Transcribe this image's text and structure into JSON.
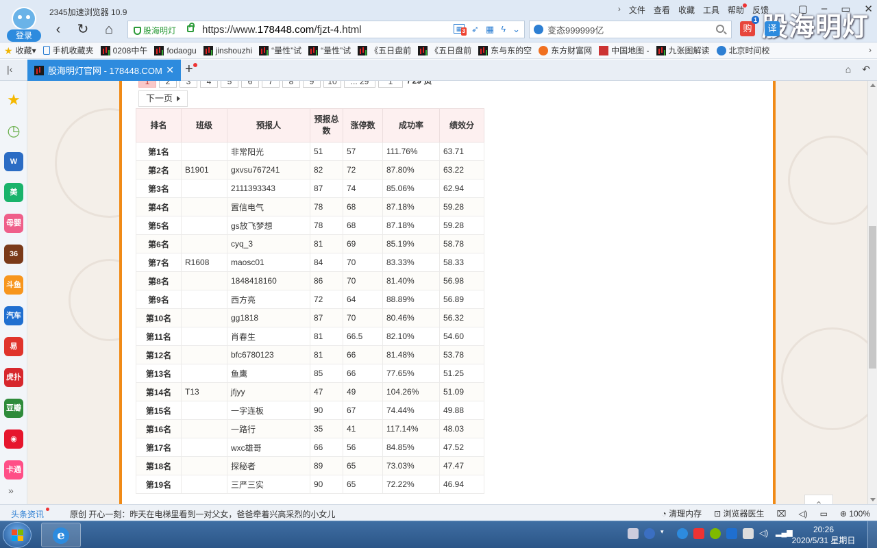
{
  "browser": {
    "app_title": "2345加速浏览器 10.9",
    "login_label": "登录",
    "menu": [
      "文件",
      "查看",
      "收藏",
      "工具",
      "帮助",
      "反馈"
    ],
    "watermark": "股海明灯",
    "address": {
      "site_badge": "股海明灯",
      "url_prefix": "https://www.",
      "url_domain": "178448.com",
      "url_path": "/fjzt-4.html",
      "badge_count": "3"
    },
    "search": {
      "value": "变态999999亿"
    },
    "buy_label": "购",
    "buy_badge": "1",
    "translate_label": "译"
  },
  "bookmarks": [
    {
      "label": "收藏",
      "icon": "star"
    },
    {
      "label": "手机收藏夹",
      "icon": "phone"
    },
    {
      "label": "0208中午",
      "icon": "stock"
    },
    {
      "label": "fodaogu",
      "icon": "stock"
    },
    {
      "label": "jinshouzhi",
      "icon": "stock"
    },
    {
      "label": "“量性”试",
      "icon": "stock"
    },
    {
      "label": "“量性”试",
      "icon": "stock"
    },
    {
      "label": "《五日盘前",
      "icon": "stock"
    },
    {
      "label": "《五日盘前",
      "icon": "stock"
    },
    {
      "label": "东与东的空",
      "icon": "stock"
    },
    {
      "label": "东方财富网",
      "icon": "hot"
    },
    {
      "label": "中国地图 -",
      "icon": "map"
    },
    {
      "label": "九张图解读",
      "icon": "stock"
    },
    {
      "label": "北京时间校",
      "icon": "paw"
    }
  ],
  "tab": {
    "title": "股海明灯官网 - 178448.COM"
  },
  "sidebar": [
    {
      "name": "favorites-icon",
      "label": "★",
      "color": "#f5b800"
    },
    {
      "name": "history-icon",
      "label": "◷",
      "color": "#6ab04c"
    },
    {
      "name": "word-icon",
      "label": "W",
      "color": "#2b6cc4"
    },
    {
      "name": "meituan-icon",
      "label": "美",
      "color": "#19b36b"
    },
    {
      "name": "muying-icon",
      "label": "母婴",
      "color": "#ef5f8a"
    },
    {
      "name": "game-icon",
      "label": "36",
      "color": "#7a3a1a"
    },
    {
      "name": "douyu-icon",
      "label": "斗鱼",
      "color": "#f7961e"
    },
    {
      "name": "car-icon",
      "label": "汽车",
      "color": "#1f6fd0"
    },
    {
      "name": "yi-icon",
      "label": "易",
      "color": "#e0342c"
    },
    {
      "name": "hupu-icon",
      "label": "虎扑",
      "color": "#d7272d"
    },
    {
      "name": "douban-icon",
      "label": "豆瓣",
      "color": "#2e8b3a"
    },
    {
      "name": "weibo-icon",
      "label": "◉",
      "color": "#e6162d"
    },
    {
      "name": "katong-icon",
      "label": "卡通",
      "color": "#ff4f87"
    }
  ],
  "pager": {
    "pages": [
      "1",
      "2",
      "3",
      "4",
      "5",
      "6",
      "7",
      "8",
      "9",
      "10",
      "... 29"
    ],
    "current": "1",
    "page_input": "1",
    "total": "/ 29 页",
    "next_label": "下一页"
  },
  "table": {
    "headers": [
      "排名",
      "班级",
      "预报人",
      "预报总数",
      "涨停数",
      "成功率",
      "绩效分"
    ],
    "rows": [
      [
        "第1名",
        "",
        "非常阳光",
        "51",
        "57",
        "111.76%",
        "63.71"
      ],
      [
        "第2名",
        "B1901",
        "gxvsu767241",
        "82",
        "72",
        "87.80%",
        "63.22"
      ],
      [
        "第3名",
        "",
        "2111393343",
        "87",
        "74",
        "85.06%",
        "62.94"
      ],
      [
        "第4名",
        "",
        "置信电气",
        "78",
        "68",
        "87.18%",
        "59.28"
      ],
      [
        "第5名",
        "",
        "gs放飞梦想",
        "78",
        "68",
        "87.18%",
        "59.28"
      ],
      [
        "第6名",
        "",
        "cyq_3",
        "81",
        "69",
        "85.19%",
        "58.78"
      ],
      [
        "第7名",
        "R1608",
        "maosc01",
        "84",
        "70",
        "83.33%",
        "58.33"
      ],
      [
        "第8名",
        "",
        "1848418160",
        "86",
        "70",
        "81.40%",
        "56.98"
      ],
      [
        "第9名",
        "",
        "西方亮",
        "72",
        "64",
        "88.89%",
        "56.89"
      ],
      [
        "第10名",
        "",
        "gg1818",
        "87",
        "70",
        "80.46%",
        "56.32"
      ],
      [
        "第11名",
        "",
        "肖春生",
        "81",
        "66.5",
        "82.10%",
        "54.60"
      ],
      [
        "第12名",
        "",
        "bfc6780123",
        "81",
        "66",
        "81.48%",
        "53.78"
      ],
      [
        "第13名",
        "",
        "鱼鹰",
        "85",
        "66",
        "77.65%",
        "51.25"
      ],
      [
        "第14名",
        "T13",
        "jfjyy",
        "47",
        "49",
        "104.26%",
        "51.09"
      ],
      [
        "第15名",
        "",
        "一字连板",
        "90",
        "67",
        "74.44%",
        "49.88"
      ],
      [
        "第16名",
        "",
        "一路行",
        "35",
        "41",
        "117.14%",
        "48.03"
      ],
      [
        "第17名",
        "",
        "wxc雄哥",
        "66",
        "56",
        "84.85%",
        "47.52"
      ],
      [
        "第18名",
        "",
        "探秘者",
        "89",
        "65",
        "73.03%",
        "47.47"
      ],
      [
        "第19名",
        "",
        "三严三实",
        "90",
        "65",
        "72.22%",
        "46.94"
      ]
    ]
  },
  "status": {
    "news_label": "头条资讯",
    "news_text": "原创 开心一刻：昨天在电梯里看到一对父女，爸爸牵着兴高采烈的小女儿",
    "clean_memory": "清理内存",
    "browser_doctor": "浏览器医生",
    "zoom": "100%"
  },
  "taskbar": {
    "time": "20:26",
    "date": "2020/5/31 星期日"
  }
}
